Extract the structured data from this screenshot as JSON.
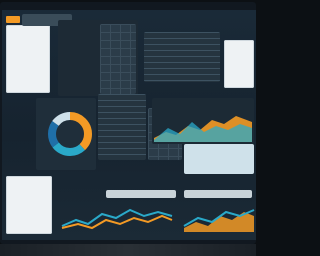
{
  "colors": {
    "accent_orange": "#f39a25",
    "accent_teal": "#2aa9c9",
    "accent_blue": "#1f6fa8",
    "background": "#16232f",
    "panel_light": "#eef2f4"
  },
  "icons": [
    "donut-chart",
    "area-chart",
    "line-chart"
  ],
  "widgets": {
    "donut_segments": [
      0.38,
      0.27,
      0.2,
      0.15
    ]
  }
}
